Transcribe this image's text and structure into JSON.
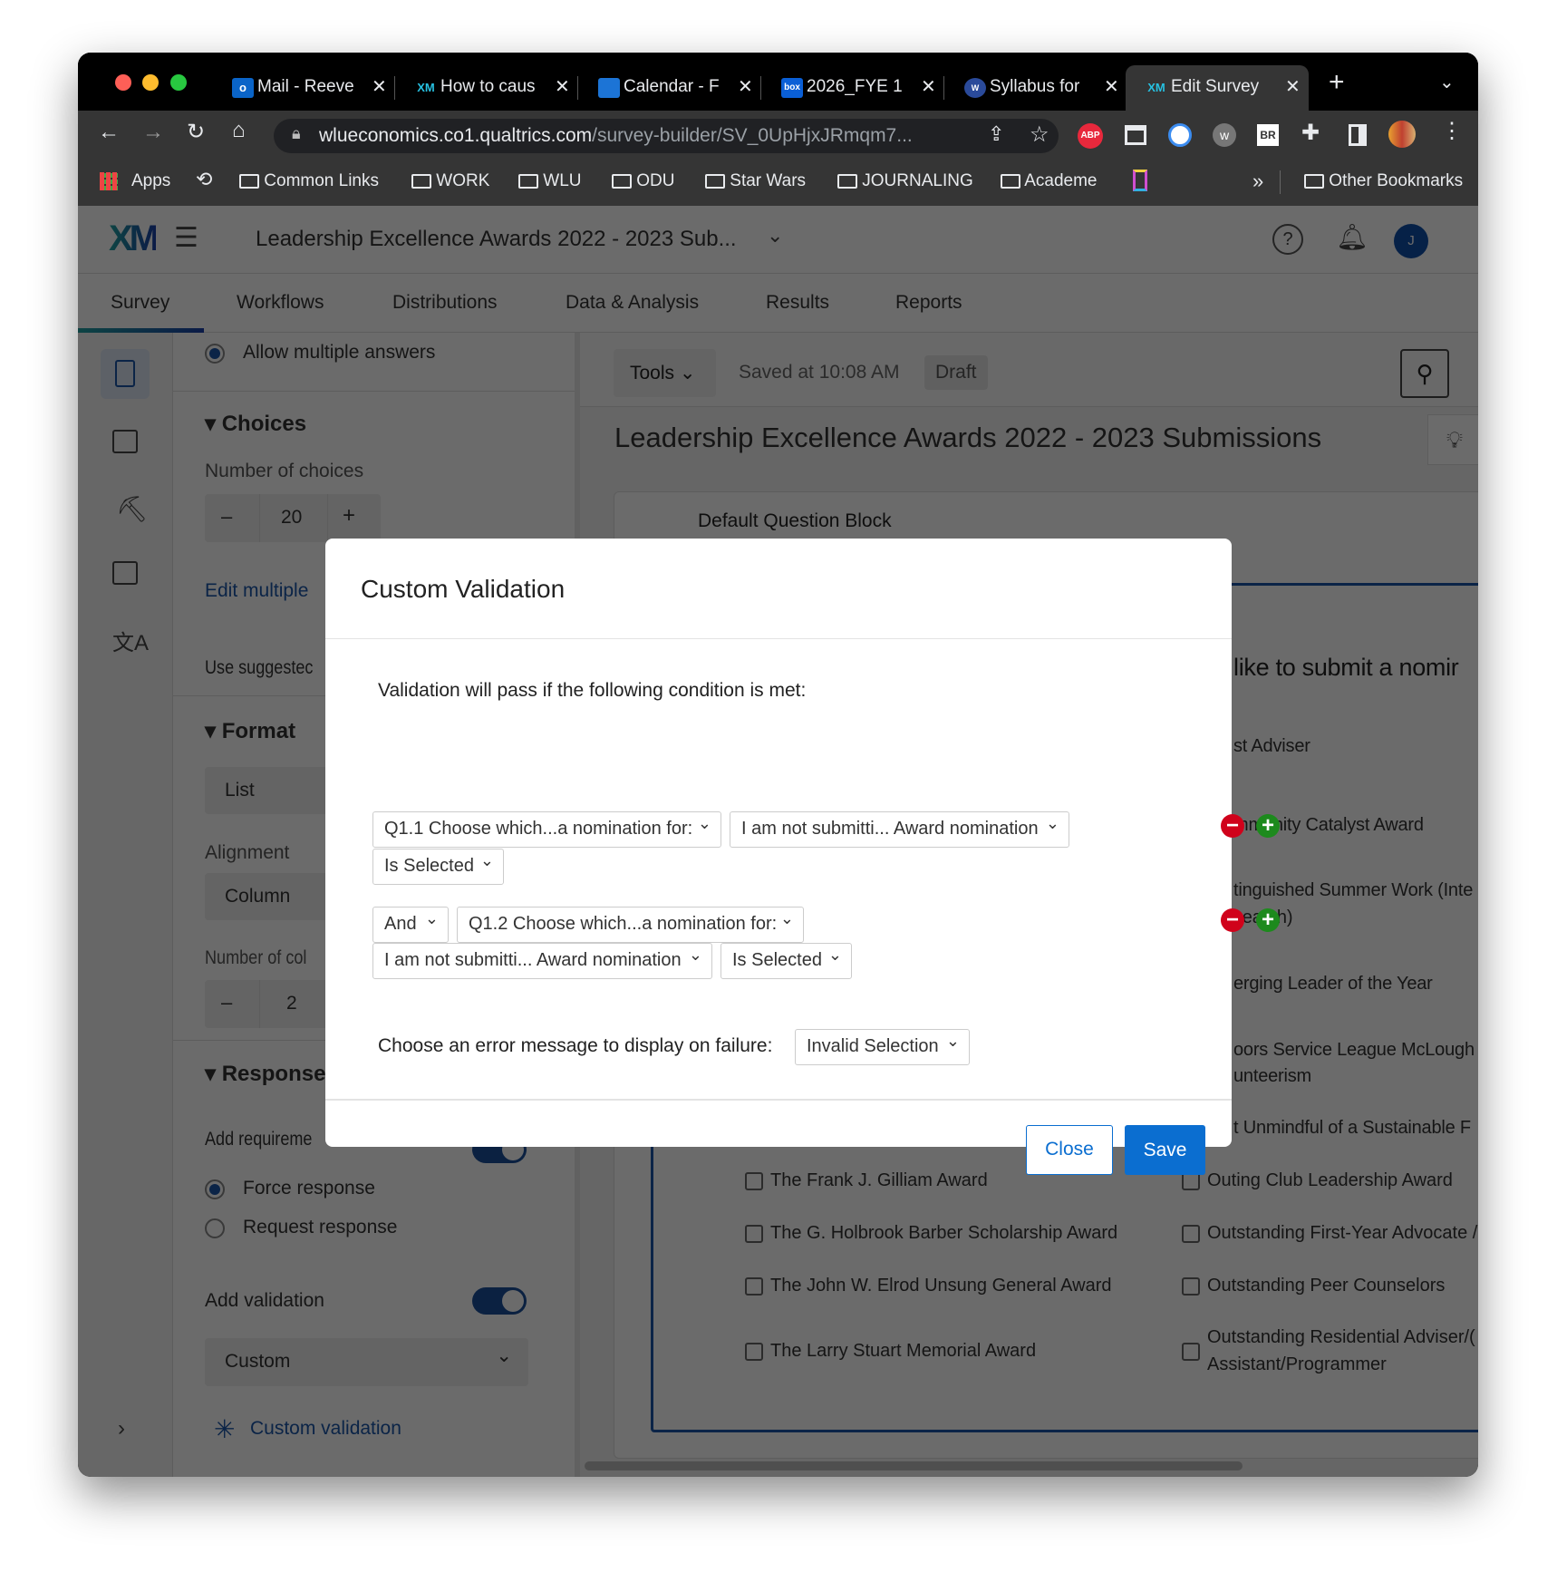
{
  "browser": {
    "tabs": [
      {
        "label": "Mail - Reeve",
        "icon": "outlook-icon"
      },
      {
        "label": "How to caus",
        "icon": "xm-icon"
      },
      {
        "label": "Calendar - F",
        "icon": "calendar-icon"
      },
      {
        "label": "2026_FYE 1",
        "icon": "box-icon"
      },
      {
        "label": "Syllabus for",
        "icon": "wlu-icon"
      },
      {
        "label": "Edit Survey",
        "icon": "xm-icon",
        "active": true
      }
    ],
    "url_host": "wlueconomics.co1.qualtrics.com",
    "url_path": "/survey-builder/SV_0UpHjxJRmqm7...",
    "bookmarks": [
      "Apps",
      "Common Links",
      "WORK",
      "WLU",
      "ODU",
      "Star Wars",
      "JOURNALING",
      "Academe"
    ],
    "other_bookmarks": "Other Bookmarks",
    "overflow": "»",
    "ext_abp": "ABP",
    "ext_br": "BR"
  },
  "app": {
    "logo": "XM",
    "title": "Leadership Excellence Awards 2022 - 2023 Sub...",
    "avatar": "J",
    "nav": [
      "Survey",
      "Workflows",
      "Distributions",
      "Data & Analysis",
      "Results",
      "Reports"
    ],
    "active_nav": "Survey"
  },
  "panel": {
    "allow_multiple": "Allow multiple answers",
    "choices_heading": "Choices",
    "num_choices_label": "Number of choices",
    "num_choices": "20",
    "edit_multiple": "Edit multiple",
    "use_suggested": "Use suggestec",
    "format_heading": "Format",
    "format_value": "List",
    "alignment_label": "Alignment",
    "alignment_value": "Column",
    "num_columns_label": "Number of col",
    "num_columns": "2",
    "response_heading": "Response",
    "add_requirement": "Add requireme",
    "force_response": "Force response",
    "request_response": "Request response",
    "add_validation": "Add validation",
    "validation_type": "Custom",
    "custom_validation_link": "Custom validation"
  },
  "main": {
    "tools": "Tools",
    "saved": "Saved at 10:08 AM",
    "draft": "Draft",
    "survey_title": "Leadership Excellence Awards 2022 - 2023 Submissions",
    "block_title": "Default Question Block",
    "question_fragment": "like to submit a nomir",
    "right_fragments": [
      "st Adviser",
      "mmunity Catalyst Award",
      "tinguished Summer Work (Inte",
      "search)",
      "erging Leader of the Year",
      "oors Service League McLough",
      "unteerism",
      "t Unmindful of a Sustainable F"
    ],
    "choices_left": [
      "The Frank J. Gilliam Award",
      "The G. Holbrook Barber Scholarship Award",
      "The John W. Elrod Unsung General Award",
      "The Larry Stuart Memorial Award"
    ],
    "choices_right": [
      "Outing Club Leadership Award",
      "Outstanding First-Year Advocate /",
      "Outstanding Peer Counselors",
      "Outstanding Residential Adviser/(",
      "Assistant/Programmer"
    ]
  },
  "dialog": {
    "title": "Custom Validation",
    "intro": "Validation will pass if the following condition is met:",
    "conditions": [
      {
        "question": "Q1.1 Choose which...a nomination for:",
        "choice": "I am not submitti... Award nomination",
        "operator": "Is Selected"
      },
      {
        "conjunction": "And",
        "question": "Q1.2 Choose which...a nomination for:",
        "choice": "I am not submitti... Award nomination",
        "operator": "Is Selected"
      }
    ],
    "error_label": "Choose an error message to display on failure:",
    "error_value": "Invalid Selection",
    "close": "Close",
    "save": "Save"
  },
  "colors": {
    "accent": "#0b6ed0",
    "remove": "#d0021b",
    "add": "#1d8a1d",
    "overlay": "rgba(0,0,0,0.6)"
  }
}
